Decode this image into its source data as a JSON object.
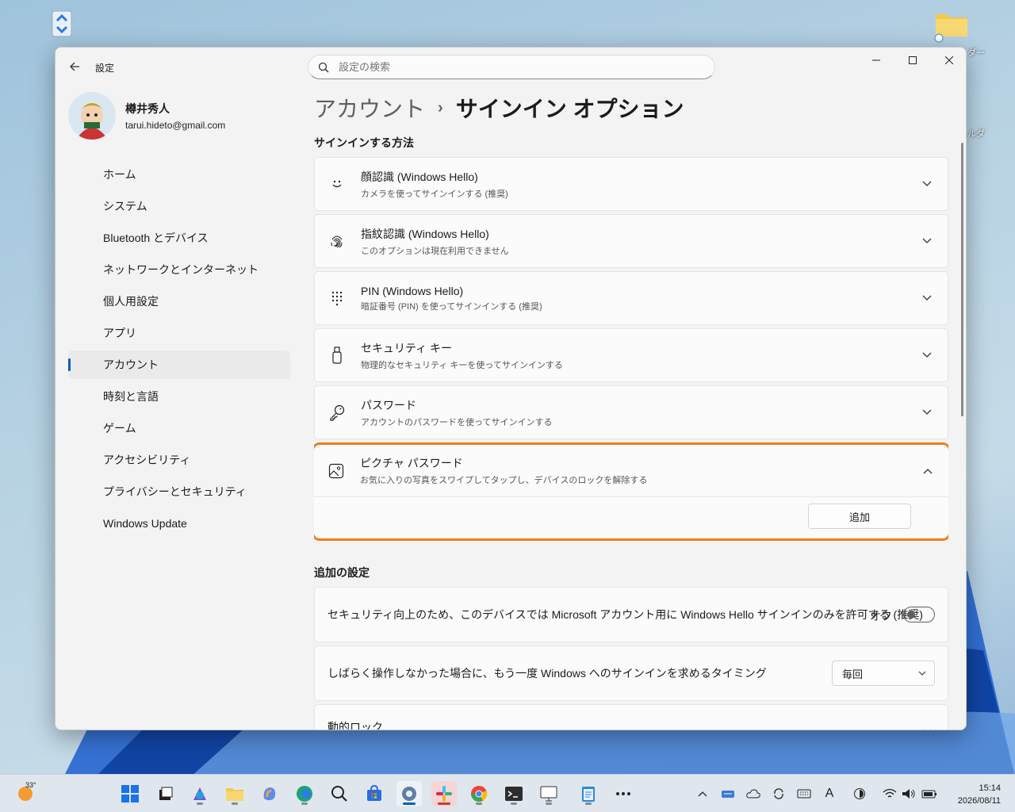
{
  "app": {
    "title": "設定"
  },
  "search": {
    "placeholder": "設定の検索"
  },
  "profile": {
    "name": "樽井秀人",
    "email": "tarui.hideto@gmail.com"
  },
  "nav": {
    "items": [
      {
        "label": "ホーム"
      },
      {
        "label": "システム"
      },
      {
        "label": "Bluetooth とデバイス"
      },
      {
        "label": "ネットワークとインターネット"
      },
      {
        "label": "個人用設定"
      },
      {
        "label": "アプリ"
      },
      {
        "label": "アカウント",
        "active": true
      },
      {
        "label": "時刻と言語"
      },
      {
        "label": "ゲーム"
      },
      {
        "label": "アクセシビリティ"
      },
      {
        "label": "プライバシーとセキュリティ"
      },
      {
        "label": "Windows Update"
      }
    ]
  },
  "breadcrumb": {
    "parent": "アカウント",
    "separator": "›",
    "current": "サインイン オプション"
  },
  "signin": {
    "section_title": "サインインする方法",
    "methods": [
      {
        "icon": "face-icon",
        "title": "顔認識 (Windows Hello)",
        "desc": "カメラを使ってサインインする (推奨)"
      },
      {
        "icon": "fingerprint-icon",
        "title": "指紋認識 (Windows Hello)",
        "desc": "このオプションは現在利用できません"
      },
      {
        "icon": "keypad-icon",
        "title": "PIN (Windows Hello)",
        "desc": "暗証番号 (PIN) を使ってサインインする (推奨)"
      },
      {
        "icon": "usb-key-icon",
        "title": "セキュリティ キー",
        "desc": "物理的なセキュリティ キーを使ってサインインする"
      },
      {
        "icon": "key-icon",
        "title": "パスワード",
        "desc": "アカウントのパスワードを使ってサインインする"
      }
    ],
    "picture_password": {
      "icon": "picture-icon",
      "title": "ピクチャ パスワード",
      "desc": "お気に入りの写真をスワイプしてタップし、デバイスのロックを解除する",
      "add_label": "追加",
      "highlight_color": "#f07d1a"
    }
  },
  "additional": {
    "section_title": "追加の設定",
    "hello_only": {
      "label": "セキュリティ向上のため、このデバイスでは Microsoft アカウント用に Windows Hello サインインのみを許可する (推奨)",
      "state": "オフ"
    },
    "timing": {
      "label": "しばらく操作しなかった場合に、もう一度 Windows へのサインインを求めるタイミング",
      "value": "毎回"
    },
    "dynamic_lock": {
      "label": "動的ロック"
    }
  },
  "taskbar": {
    "weather": "33°",
    "time": "15:14",
    "date": "2026/08/11",
    "ime": "A"
  },
  "desktop": {
    "label_right_1": "ダー",
    "label_right_2": "ルダ"
  },
  "colors": {
    "accent": "#005fb8",
    "highlight": "#f07d1a"
  }
}
